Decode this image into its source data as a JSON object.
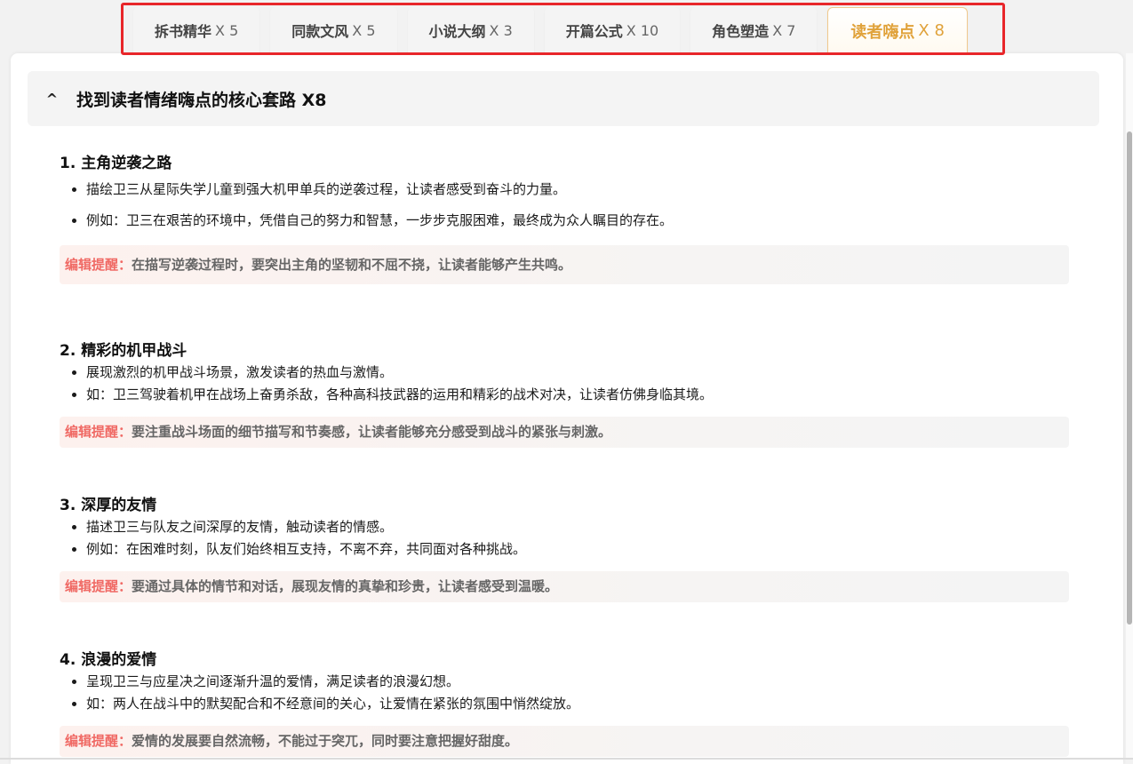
{
  "tabs": [
    {
      "name": "拆书精华",
      "count": "X 5"
    },
    {
      "name": "同款文风",
      "count": "X 5"
    },
    {
      "name": "小说大纲",
      "count": "X 3"
    },
    {
      "name": "开篇公式",
      "count": "X 10"
    },
    {
      "name": "角色塑造",
      "count": "X 7"
    },
    {
      "name": "读者嗨点",
      "count": "X 8",
      "active": true
    }
  ],
  "section": {
    "collapse_icon": "^",
    "title": "找到读者情绪嗨点的核心套路 X8"
  },
  "tip_label": "编辑提醒：",
  "items": [
    {
      "title": "1. 主角逆袭之路",
      "bullets": [
        "描绘卫三从星际失学儿童到强大机甲单兵的逆袭过程，让读者感受到奋斗的力量。",
        "例如：卫三在艰苦的环境中，凭借自己的努力和智慧，一步步克服困难，最终成为众人瞩目的存在。"
      ],
      "tip": "在描写逆袭过程时，要突出主角的坚韧和不屈不挠，让读者能够产生共鸣。"
    },
    {
      "title": "2. 精彩的机甲战斗",
      "bullets": [
        "展现激烈的机甲战斗场景，激发读者的热血与激情。",
        "如：卫三驾驶着机甲在战场上奋勇杀敌，各种高科技武器的运用和精彩的战术对决，让读者仿佛身临其境。"
      ],
      "tip": "要注重战斗场面的细节描写和节奏感，让读者能够充分感受到战斗的紧张与刺激。"
    },
    {
      "title": "3. 深厚的友情",
      "bullets": [
        "描述卫三与队友之间深厚的友情，触动读者的情感。",
        "例如：在困难时刻，队友们始终相互支持，不离不弃，共同面对各种挑战。"
      ],
      "tip": "要通过具体的情节和对话，展现友情的真挚和珍贵，让读者感受到温暖。"
    },
    {
      "title": "4. 浪漫的爱情",
      "bullets": [
        "呈现卫三与应星决之间逐渐升温的爱情，满足读者的浪漫幻想。",
        "如：两人在战斗中的默契配合和不经意间的关心，让爱情在紧张的氛围中悄然绽放。"
      ],
      "tip": "爱情的发展要自然流畅，不能过于突兀，同时要注意把握好甜度。"
    }
  ],
  "colors": {
    "active_tab": "#e0a23a",
    "tip_label": "#f06a65",
    "highlight_border": "#e8262a"
  }
}
